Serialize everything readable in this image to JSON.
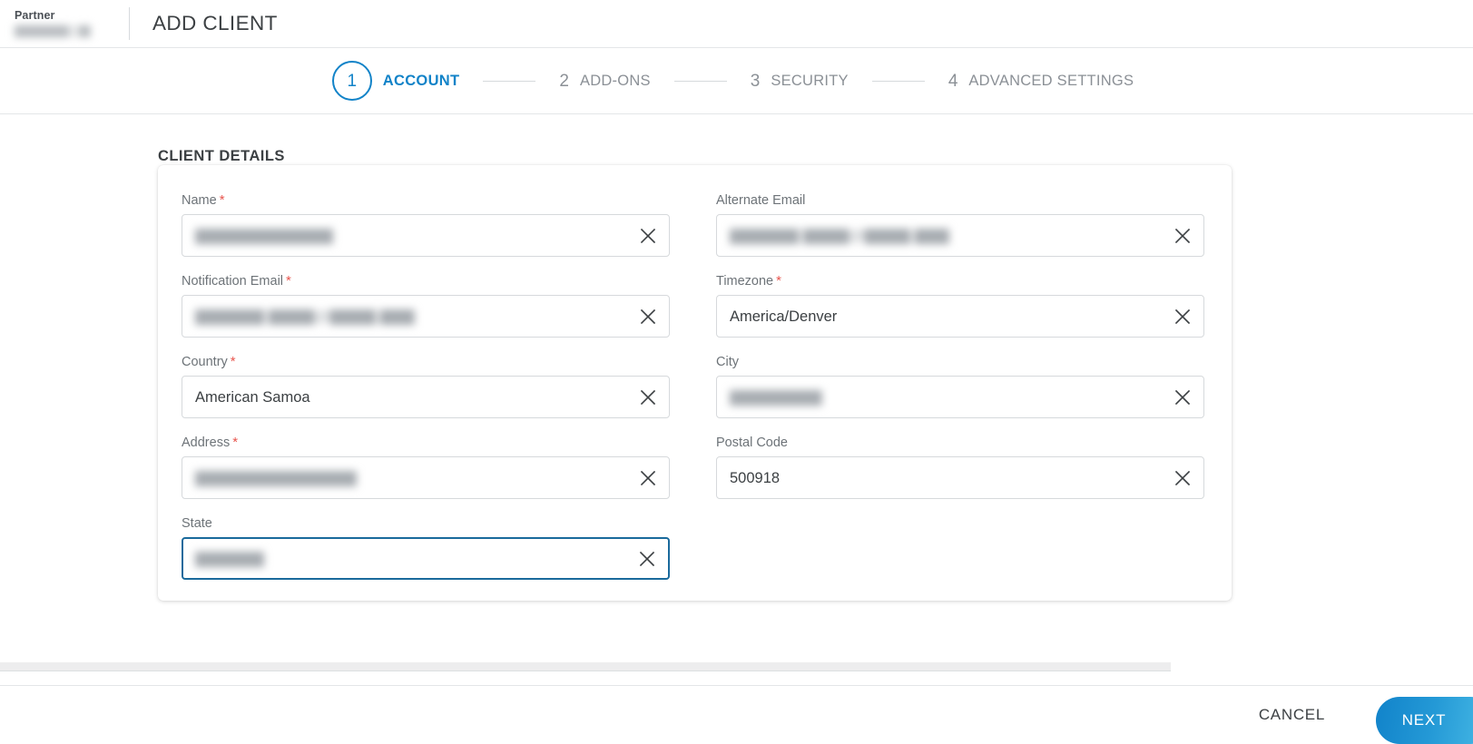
{
  "header": {
    "partner_label": "Partner",
    "partner_name": "▇▇▇▇▇▇ ▇▇",
    "title": "ADD CLIENT"
  },
  "stepper": {
    "steps": [
      {
        "num": "1",
        "label": "ACCOUNT",
        "active": true
      },
      {
        "num": "2",
        "label": "ADD-ONS",
        "active": false
      },
      {
        "num": "3",
        "label": "SECURITY",
        "active": false
      },
      {
        "num": "4",
        "label": "ADVANCED SETTINGS",
        "active": false
      }
    ]
  },
  "form": {
    "section_title": "CLIENT DETAILS",
    "left": [
      {
        "label": "Name",
        "required": true,
        "value": "▇▇▇▇▇▇▇▇▇▇▇▇",
        "blurred": true,
        "focused": false,
        "clear": true
      },
      {
        "label": "Notification Email",
        "required": true,
        "value": "▇▇▇▇▇▇ ▇▇▇▇@▇▇▇▇.▇▇▇",
        "blurred": true,
        "focused": false,
        "clear": true
      },
      {
        "label": "Country",
        "required": true,
        "value": "American Samoa",
        "blurred": false,
        "focused": false,
        "clear": true
      },
      {
        "label": "Address",
        "required": true,
        "value": "▇▇▇▇▇▇▇▇▇▇▇▇▇▇",
        "blurred": true,
        "focused": false,
        "clear": true
      },
      {
        "label": "State",
        "required": false,
        "value": "▇▇▇▇▇▇",
        "blurred": true,
        "focused": true,
        "clear": true
      }
    ],
    "right": [
      {
        "label": "Alternate Email",
        "required": false,
        "value": "▇▇▇▇▇▇ ▇▇▇▇@▇▇▇▇.▇▇▇",
        "blurred": true,
        "focused": false,
        "clear": true
      },
      {
        "label": "Timezone",
        "required": true,
        "value": "America/Denver",
        "blurred": false,
        "focused": false,
        "clear": true
      },
      {
        "label": "City",
        "required": false,
        "value": "▇▇▇▇▇▇▇▇",
        "blurred": true,
        "focused": false,
        "clear": true
      },
      {
        "label": "Postal Code",
        "required": false,
        "value": "500918",
        "blurred": false,
        "focused": false,
        "clear": true
      }
    ]
  },
  "footer": {
    "cancel_label": "CANCEL",
    "next_label": "NEXT"
  },
  "colors": {
    "accent": "#1283c8",
    "required": "#e8554e",
    "focus_border": "#1a6a9c",
    "label": "#6d7378",
    "next_gradient_from": "#1183ca",
    "next_gradient_to": "#49bbe6"
  }
}
